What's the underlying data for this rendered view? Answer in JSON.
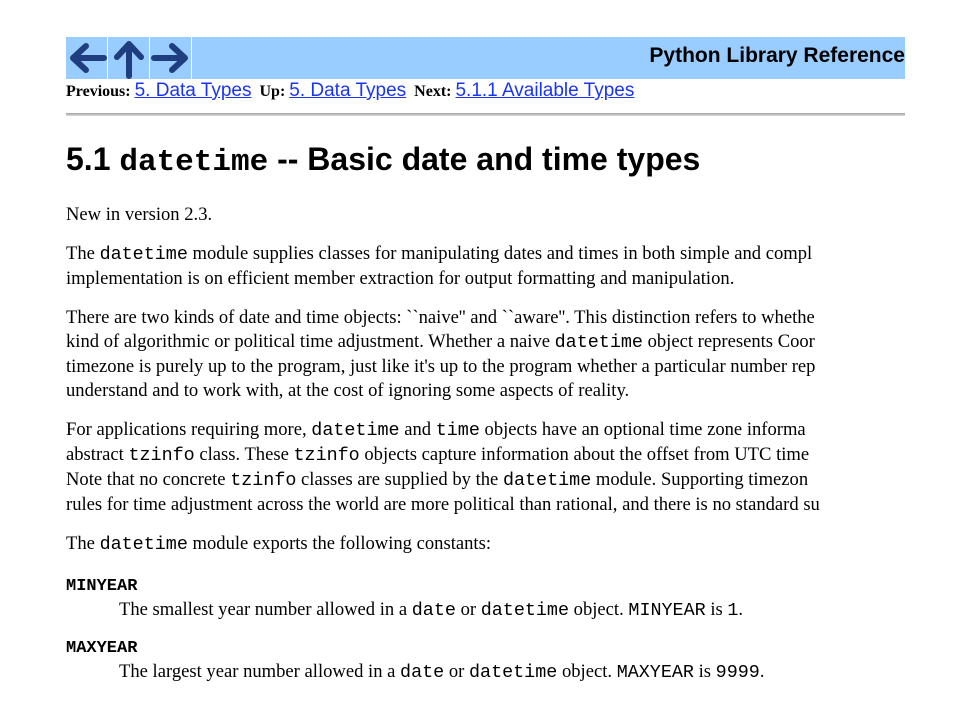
{
  "navigation": {
    "previous_button": "previous page arrow",
    "up_button": "up one level arrow",
    "next_button": "next page arrow",
    "doc_title": "Python Library Reference",
    "previous_label": "Previous:",
    "previous_link": "5. Data Types",
    "up_label": "Up:",
    "up_link": "5. Data Types",
    "next_label": "Next:",
    "next_link": "5.1.1 Available Types"
  },
  "heading": {
    "number": "5.1",
    "module": "datetime",
    "rest": "-- Basic date and time types"
  },
  "intro": {
    "version_note": "New in version 2.3."
  },
  "para1": {
    "l1a": "The ",
    "l1b": "datetime",
    "l1c": " module supplies classes for manipulating dates and times in both simple and compl",
    "l2": "implementation is on efficient member extraction for output formatting and manipulation."
  },
  "para2": {
    "l1": "There are two kinds of date and time objects: ``naive'' and ``aware''. This distinction refers to whethe",
    "l2a": "kind of algorithmic or political time adjustment. Whether a naive ",
    "l2b": "datetime",
    "l2c": " object represents Coor",
    "l3": "timezone is purely up to the program, just like it's up to the program whether a particular number rep",
    "l4": "understand and to work with, at the cost of ignoring some aspects of reality."
  },
  "para3": {
    "l1a": "For applications requiring more, ",
    "l1b": "datetime",
    "l1c": " and ",
    "l1d": "time",
    "l1e": " objects have an optional time zone informa",
    "l2a": "abstract ",
    "l2b": "tzinfo",
    "l2c": " class. These ",
    "l2d": "tzinfo",
    "l2e": " objects capture information about the offset from UTC time",
    "l3a": "Note that no concrete ",
    "l3b": "tzinfo",
    "l3c": " classes are supplied by the ",
    "l3d": "datetime",
    "l3e": " module. Supporting timezon",
    "l4": "rules for time adjustment across the world are more political than rational, and there is no standard su"
  },
  "para4": {
    "a": "The ",
    "b": "datetime",
    "c": " module exports the following constants:"
  },
  "constants": [
    {
      "name": "MINYEAR",
      "d1": "The smallest year number allowed in a ",
      "d2": "date",
      "d3": " or ",
      "d4": "datetime",
      "d5": " object. ",
      "d6": "MINYEAR",
      "d7": " is ",
      "d8": "1",
      "d9": "."
    },
    {
      "name": "MAXYEAR",
      "d1": "The largest year number allowed in a ",
      "d2": "date",
      "d3": " or ",
      "d4": "datetime",
      "d5": " object. ",
      "d6": "MAXYEAR",
      "d7": " is ",
      "d8": "9999",
      "d9": "."
    }
  ]
}
